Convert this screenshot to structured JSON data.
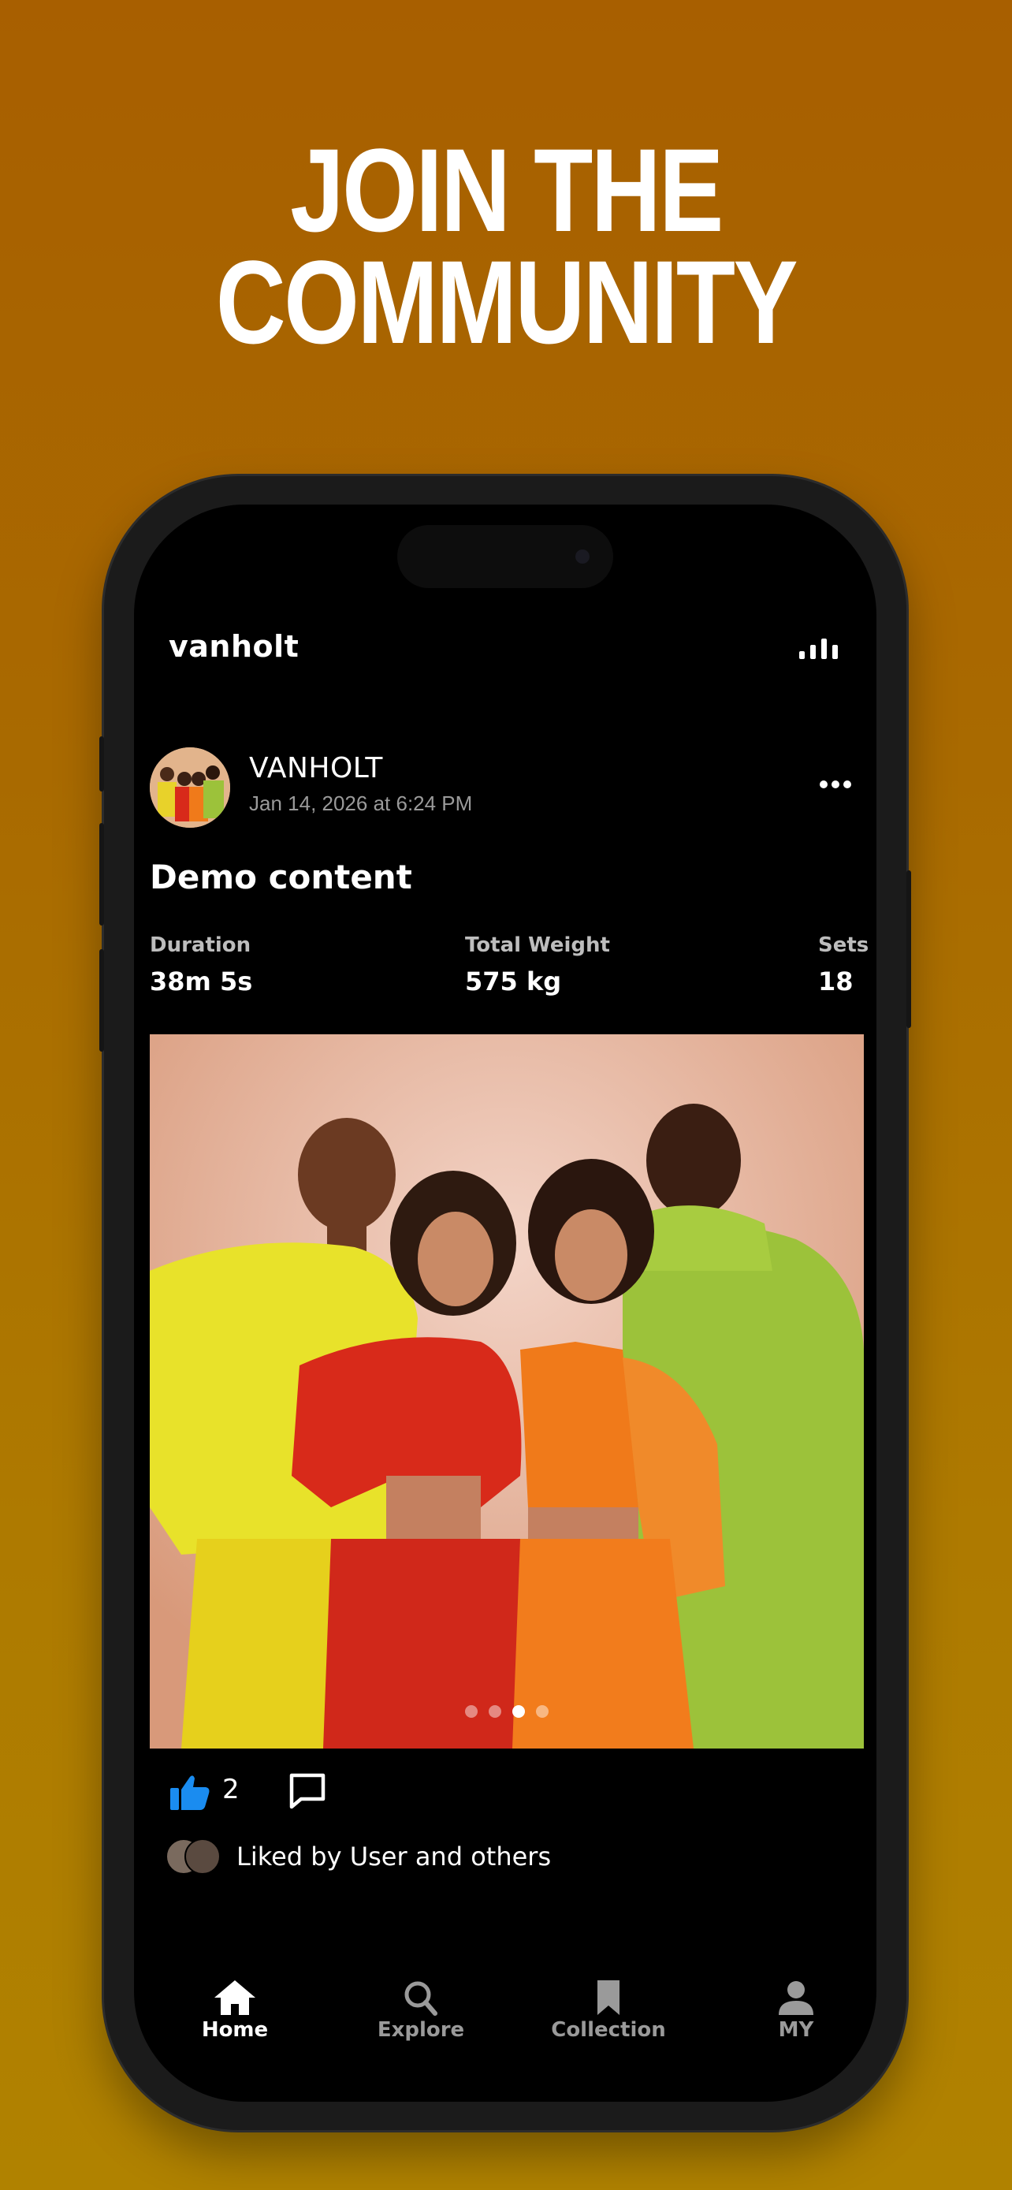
{
  "promo": {
    "line1": "JOIN THE",
    "line2": "COMMUNITY"
  },
  "app": {
    "brand": "vanholt",
    "header_icon": "signal-bars-icon"
  },
  "post": {
    "author": "VANHOLT",
    "date": "Jan 14, 2026 at 6:24 PM",
    "title": "Demo content",
    "stats": [
      {
        "label": "Duration",
        "value": "38m 5s"
      },
      {
        "label": "Total Weight",
        "value": "575 kg"
      },
      {
        "label": "Sets",
        "value": "18"
      }
    ],
    "carousel": {
      "count": 4,
      "active_index": 2
    },
    "likes": "2",
    "liked_by": "Liked by User and others"
  },
  "tabs": [
    {
      "label": "Home",
      "icon": "home-icon",
      "active": true
    },
    {
      "label": "Explore",
      "icon": "search-icon",
      "active": false
    },
    {
      "label": "Collection",
      "icon": "bookmark-icon",
      "active": false
    },
    {
      "label": "MY",
      "icon": "profile-icon",
      "active": false
    }
  ],
  "colors": {
    "background_top": "#a85f00",
    "background_bottom": "#b08200",
    "like_blue": "#1a8cf0",
    "tab_active": "#ffffff",
    "tab_inactive": "#9a9a9a"
  }
}
